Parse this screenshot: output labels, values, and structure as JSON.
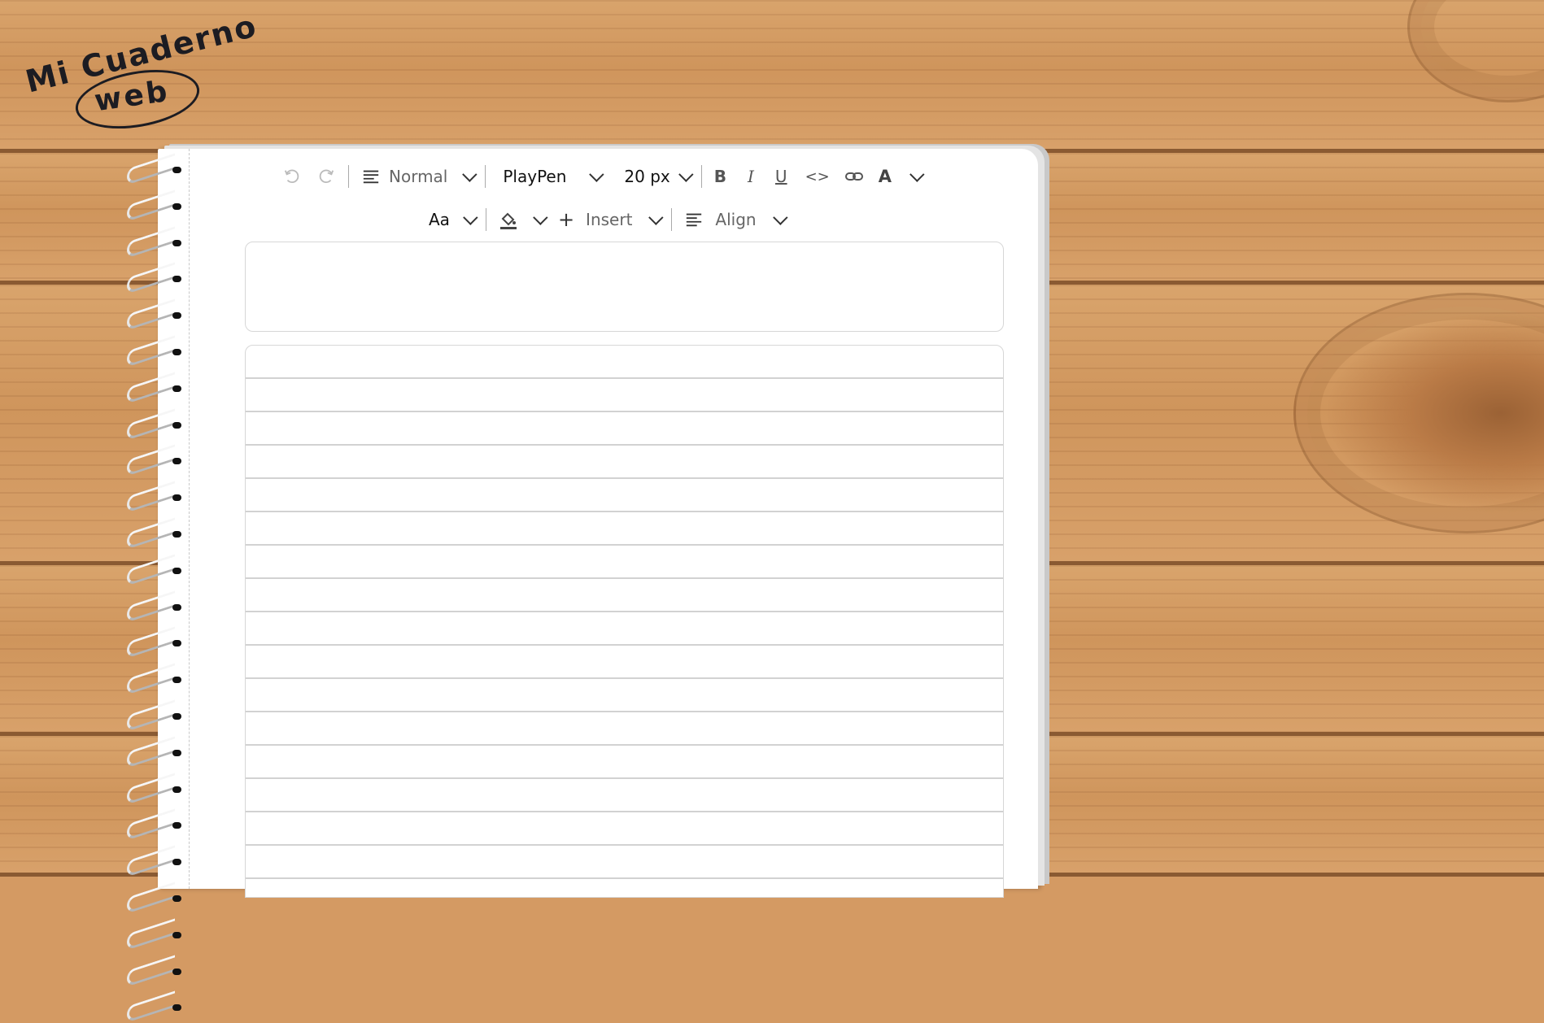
{
  "app": {
    "logo_top": "Mi Cuaderno",
    "logo_bottom": "web"
  },
  "toolbar": {
    "undo_icon": "undo-icon",
    "redo_icon": "redo-icon",
    "block_type": "Normal",
    "font_family": "PlayPen",
    "font_size": "20 px",
    "bold_label": "B",
    "italic_label": "I",
    "underline_label": "U",
    "code_label": "<>",
    "font_color_label": "A",
    "text_case_label": "Aa",
    "insert_label": "Insert",
    "align_label": "Align"
  },
  "editor": {
    "title_value": "",
    "body_value": ""
  },
  "colors": {
    "wood": "#d49a63",
    "wood_seam": "#8a5a32",
    "paper": "#ffffff",
    "ink": "#1c1c22"
  }
}
